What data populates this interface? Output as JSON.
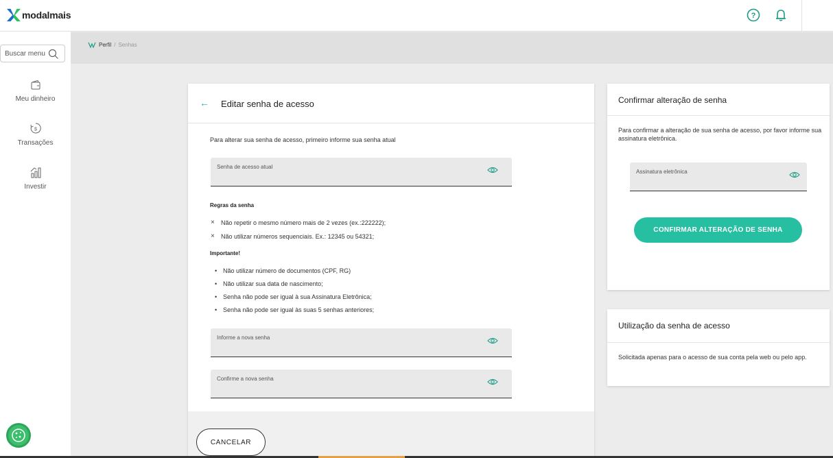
{
  "header": {
    "brand": "modalmais",
    "icons": [
      "help-icon",
      "bell-icon"
    ]
  },
  "sidebar": {
    "search_placeholder": "Buscar menu",
    "items": [
      {
        "label": "Meu dinheiro",
        "icon": "wallet-icon"
      },
      {
        "label": "Transações",
        "icon": "transactions-icon"
      },
      {
        "label": "Investir",
        "icon": "invest-icon"
      }
    ]
  },
  "breadcrumb": {
    "first": "Perfil",
    "separator": "/",
    "current": "Senhas"
  },
  "edit_card": {
    "title": "Editar senha de acesso",
    "intro": "Para alterar sua senha de acesso, primeiro informe sua senha atual",
    "current_password_label": "Senha de acesso atual",
    "rules_title": "Regras da senha",
    "rules": [
      "Não repetir o mesmo número mais de 2 vezes (ex.:222222);",
      "Não utilizar números sequenciais. Ex.: 12345 ou 54321;"
    ],
    "important_title": "Importante!",
    "important_items": [
      "Não utilizar número de documentos (CPF, RG)",
      "Não utilizar sua data de nascimento;",
      "Senha não pode ser igual à sua Assinatura Eletrônica;",
      "Senha não pode ser igual às suas 5 senhas anteriores;"
    ],
    "new_password_label": "Informe a nova senha",
    "confirm_password_label": "Confirme a nova senha",
    "cancel_label": "CANCELAR"
  },
  "confirm_card": {
    "title": "Confirmar alteração de senha",
    "text": "Para confirmar a alteração de sua senha de acesso, por favor informe sua assinatura eletrônica.",
    "signature_label": "Assinatura eletrônica",
    "confirm_label": "CONFIRMAR ALTERAÇÃO DE SENHA"
  },
  "usage_card": {
    "title": "Utilização da senha de acesso",
    "text": "Solicitada apenas para o acesso de sua conta pela web ou pelo app."
  },
  "colors": {
    "accent": "#27bfa1",
    "back_arrow": "#2aa6b8",
    "cookie": "#3cbf6c"
  }
}
